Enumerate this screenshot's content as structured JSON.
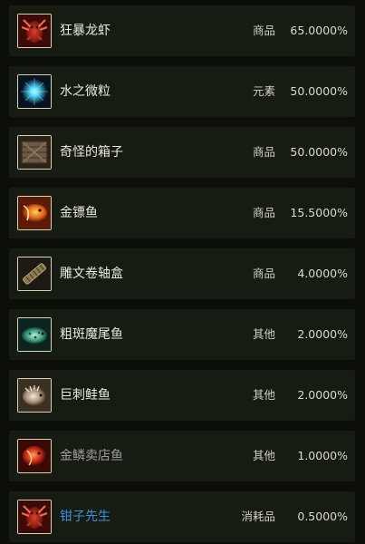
{
  "drops": [
    {
      "name": "狂暴龙虾",
      "type": "商品",
      "prob": "65.0000%",
      "icon": "lobster-icon",
      "name_color": "#e9e9e2"
    },
    {
      "name": "水之微粒",
      "type": "元素",
      "prob": "50.0000%",
      "icon": "water-mote-icon",
      "name_color": "#e9e9e2"
    },
    {
      "name": "奇怪的箱子",
      "type": "商品",
      "prob": "50.0000%",
      "icon": "crate-icon",
      "name_color": "#e9e9e2"
    },
    {
      "name": "金镖鱼",
      "type": "商品",
      "prob": "15.5000%",
      "icon": "golden-darter-icon",
      "name_color": "#e9e9e2"
    },
    {
      "name": "雕文卷轴盒",
      "type": "商品",
      "prob": "4.0000%",
      "icon": "scroll-case-icon",
      "name_color": "#e9e9e2"
    },
    {
      "name": "粗斑魔尾鱼",
      "type": "其他",
      "prob": "2.0000%",
      "icon": "spotted-fish-icon",
      "name_color": "#e9e9e2"
    },
    {
      "name": "巨刺鲑鱼",
      "type": "其他",
      "prob": "2.0000%",
      "icon": "spiny-salmon-icon",
      "name_color": "#e9e9e2"
    },
    {
      "name": "金鳞卖店鱼",
      "type": "其他",
      "prob": "1.0000%",
      "icon": "goldscale-fish-icon",
      "name_color": "#9d9d9d"
    },
    {
      "name": "钳子先生",
      "type": "消耗品",
      "prob": "0.5000%",
      "icon": "lobster-icon",
      "name_color": "#3d8fe0"
    }
  ]
}
